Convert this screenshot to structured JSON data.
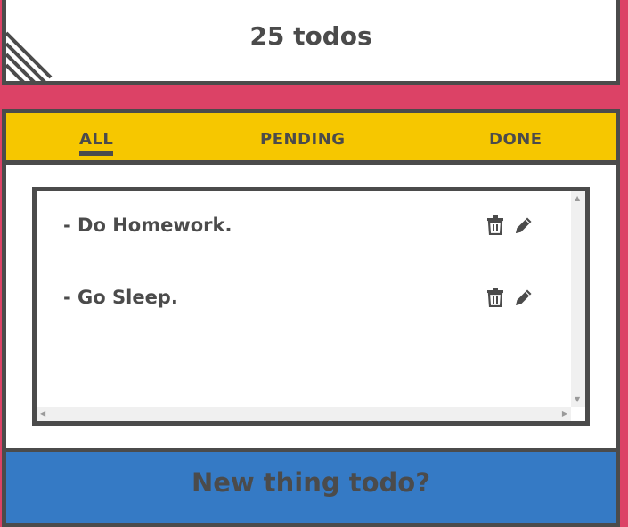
{
  "header": {
    "count_label": "25 todos"
  },
  "tabs": [
    {
      "label": "ALL",
      "active": true
    },
    {
      "label": "PENDING",
      "active": false
    },
    {
      "label": "DONE",
      "active": false
    }
  ],
  "todos": [
    {
      "text": "- Do Homework.",
      "actions": [
        "trash-icon",
        "pencil-icon"
      ]
    },
    {
      "text": "- Go Sleep.",
      "actions": [
        "trash-icon",
        "pencil-icon"
      ]
    }
  ],
  "footer": {
    "new_todo_label": "New thing todo?"
  },
  "colors": {
    "background": "#dc4266",
    "tabs_bar": "#f6c700",
    "footer": "#357ac5",
    "text": "#4b4b4b"
  }
}
